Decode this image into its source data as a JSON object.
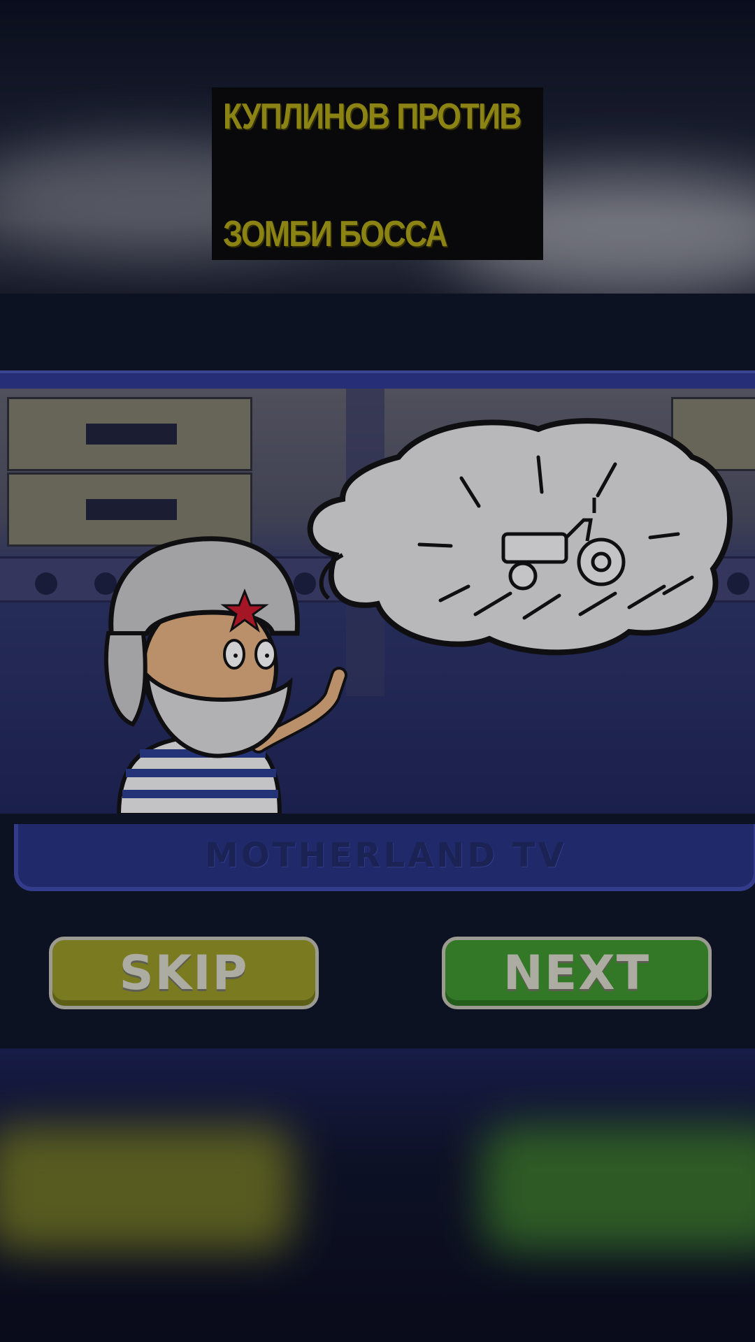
{
  "title": {
    "line1": "КУПЛИНОВ ПРОТИВ",
    "line2": "ЗОМБИ БОССА"
  },
  "game": {
    "tv_label": "MOTHERLAND TV",
    "thought_content": "tractor-icon",
    "skip_label": "SKIP",
    "next_label": "NEXT"
  },
  "colors": {
    "title_text": "#a39a14",
    "skip_button": "#8f8f24",
    "next_button": "#3a8c2a",
    "tv_frame": "#2b3688"
  }
}
